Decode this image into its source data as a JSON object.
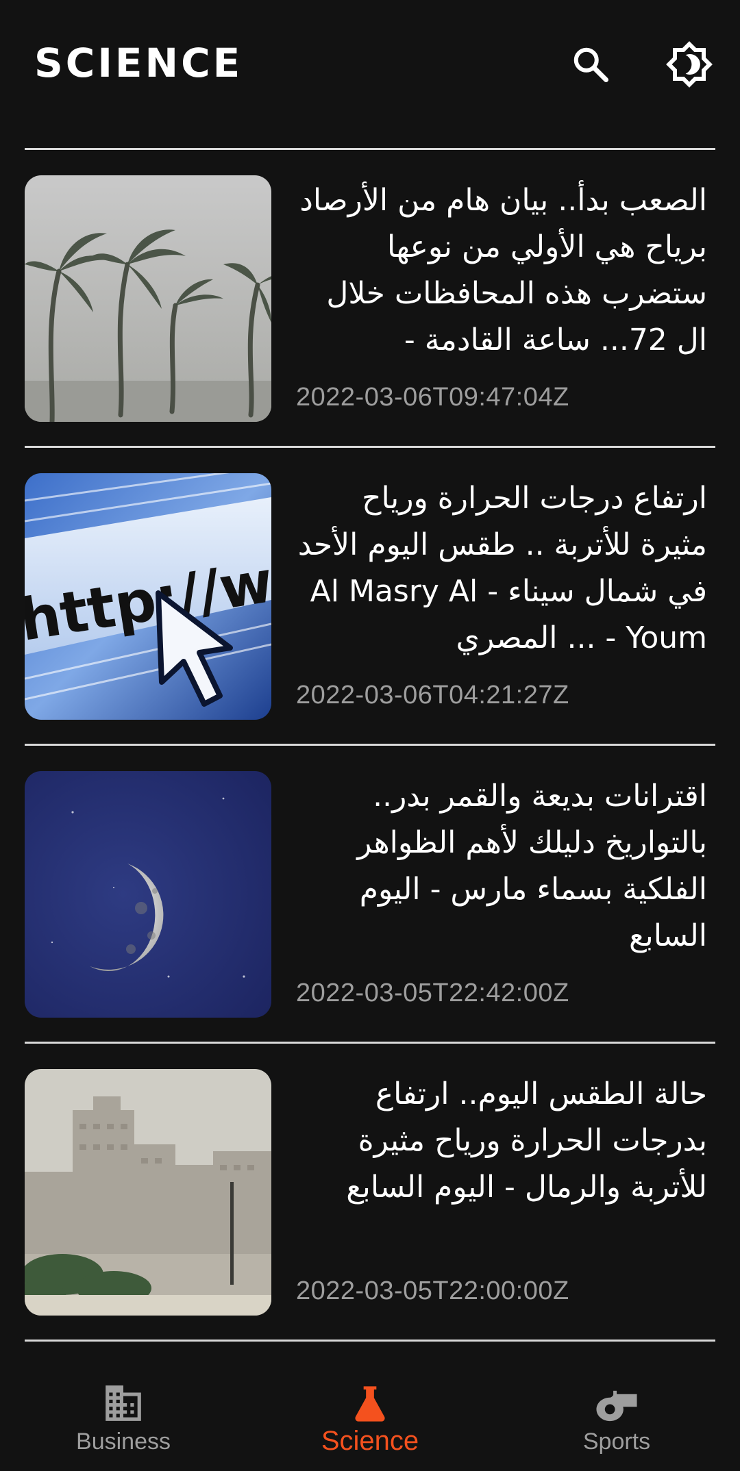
{
  "header": {
    "title": "SCIENCE",
    "search_icon": "search-icon",
    "theme_icon": "brightness-icon"
  },
  "articles": [
    {
      "headline": "الصعب بدأ.. بيان هام من الأرصاد برياح هي الأولي من نوعها ستضرب هذه المحافظات خلال ال 72... ساعة القادمة -",
      "published": "2022-03-06T09:47:04Z",
      "image": "palm-trees-storm"
    },
    {
      "headline": "ارتفاع درجات الحرارة ورياح مثيرة للأتربة .. طقس اليوم الأحد في شمال سيناء - Al Masry Al Youm - ... المصري",
      "published": "2022-03-06T04:21:27Z",
      "image": "http-url-cursor"
    },
    {
      "headline": "اقترانات بديعة والقمر بدر.. بالتواريخ دليلك لأهم الظواهر الفلكية بسماء مارس - اليوم السابع",
      "published": "2022-03-05T22:42:00Z",
      "image": "crescent-moon"
    },
    {
      "headline": "حالة الطقس اليوم.. ارتفاع بدرجات الحرارة ورياح مثيرة للأتربة والرمال - اليوم السابع",
      "published": "2022-03-05T22:00:00Z",
      "image": "dusty-city"
    }
  ],
  "bottom_nav": {
    "items": [
      {
        "label": "Business",
        "icon": "building-icon",
        "active": false
      },
      {
        "label": "Science",
        "icon": "flask-icon",
        "active": true
      },
      {
        "label": "Sports",
        "icon": "whistle-icon",
        "active": false
      }
    ]
  },
  "colors": {
    "background": "#121212",
    "accent": "#f4511e",
    "text": "#ffffff",
    "muted": "#9e9e9e",
    "divider": "#d9d9d9"
  }
}
